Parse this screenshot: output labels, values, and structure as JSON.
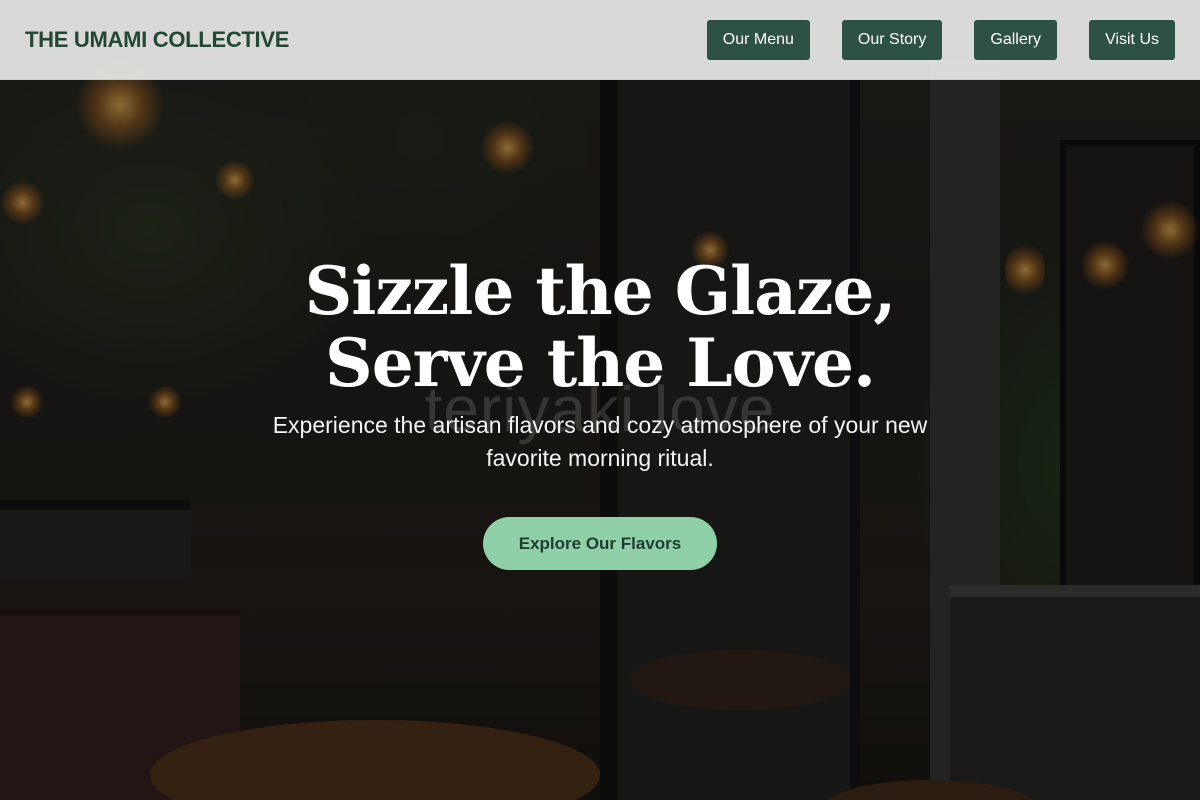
{
  "header": {
    "brand": "THE UMAMI COLLECTIVE",
    "nav": [
      {
        "label": "Our Menu"
      },
      {
        "label": "Our Story"
      },
      {
        "label": "Gallery"
      },
      {
        "label": "Visit Us"
      }
    ]
  },
  "hero": {
    "background_watermark": "teriyaki love",
    "headline_line1": "Sizzle the Glaze,",
    "headline_line2": "Serve the Love.",
    "subtitle": "Experience the artisan flavors and cozy atmosphere of your new favorite morning ritual.",
    "cta_label": "Explore Our Flavors"
  },
  "colors": {
    "brand_green": "#234735",
    "nav_button_bg": "#2d5144",
    "cta_bg": "#8fd0a8",
    "header_bg": "#e8e8e6"
  }
}
